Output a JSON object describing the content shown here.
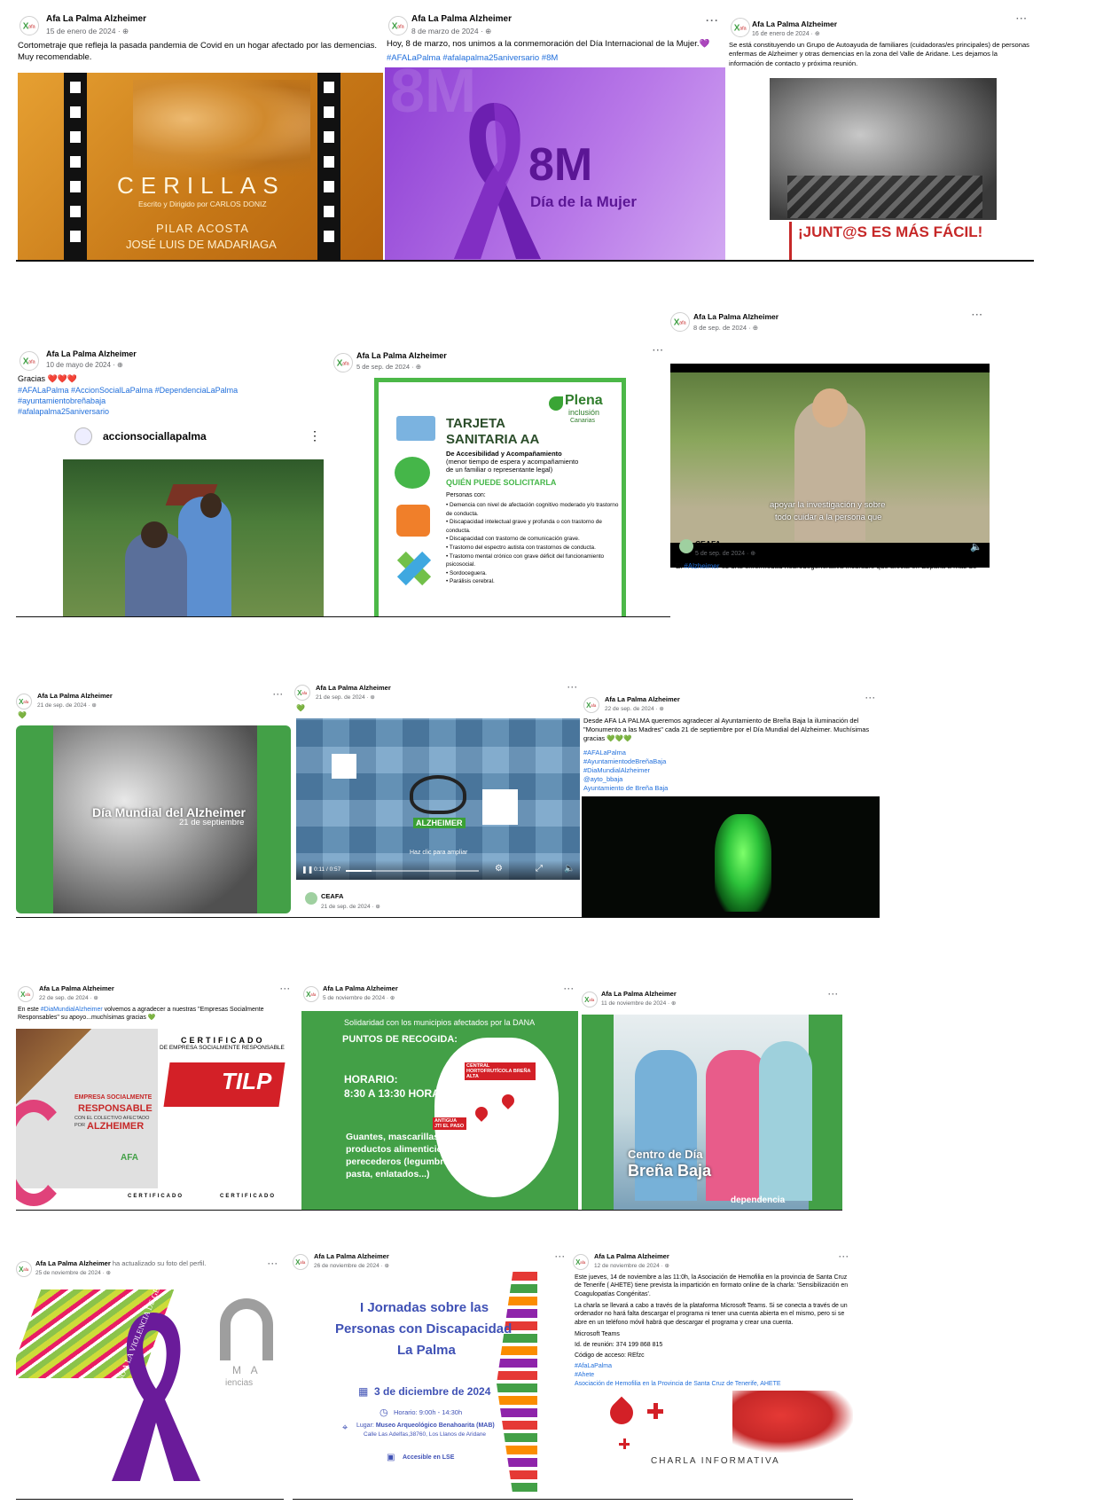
{
  "author": "Afa La Palma Alzheimer",
  "more_label": "···",
  "posts": {
    "p1": {
      "date": "15 de enero de 2024 · ⊕",
      "text": "Cortometraje que refleja la pasada pandemia de Covid en un hogar afectado por las demencias. Muy recomendable.",
      "poster_title": "CERILLAS",
      "poster_sub": "Escrito y Dirigido por CARLOS DONIZ",
      "poster_actor1": "PILAR ACOSTA",
      "poster_actor2": "JOSÉ LUIS DE MADARIAGA"
    },
    "p2": {
      "date": "8 de marzo de 2024 · ⊕",
      "text": "Hoy, 8 de marzo, nos unimos a la conmemoración del Día Internacional de la Mujer.💜",
      "tags": "#AFALaPalma #afalapalma25aniversario #8M",
      "big": "8M",
      "sub": "Día de la Mujer",
      "bg_word": "8M"
    },
    "p3": {
      "date": "16 de enero de 2024 · ⊕",
      "text": "Se está constituyendo un Grupo de Autoayuda de familiares (cuidadoras/es principales) de personas enfermas de Alzheimer y otras demencias en la zona del Valle de Aridane. Les dejamos la información de contacto y próxima reunión.",
      "slogan": "¡JUNT@S ES MÁS FÁCIL!"
    },
    "p4": {
      "date": "10 de mayo de 2024 · ⊕",
      "text": "Gracias ❤️❤️❤️",
      "tags1": "#AFALaPalma #AccionSocialLaPalma #DependenciaLaPalma",
      "tags2": "#ayuntamientobreñabaja",
      "tags3": "#afalapalma25aniversario",
      "ig_account": "accionsociallapalma",
      "ig_more": "⋮"
    },
    "p5": {
      "date": "5 de sep. de 2024 · ⊕",
      "logo1": "Plena",
      "logo2": "inclusión",
      "logo3": "Canarias",
      "title1": "TARJETA",
      "title2": "SANITARIA AA",
      "desc1": "De Accesibilidad y Acompañamiento",
      "desc2": "(menor tiempo de espera y acompañamiento",
      "desc3": "de un familiar o representante legal)",
      "who": "QUIÉN PUEDE SOLICITARLA",
      "people": "Personas con:",
      "items": [
        "Demencia con nivel de afectación cognitivo moderado y/o trastorno de conducta.",
        "Discapacidad intelectual grave y profunda o con trastorno de conducta.",
        "Discapacidad con trastorno de comunicación grave.",
        "Trastorno del espectro autista con trastornos de conducta.",
        "Trastorno mental crónico con grave déficit del funcionamiento psicosocial.",
        "Sordoceguera.",
        "Parálisis cerebral."
      ]
    },
    "p6": {
      "date": "8 de sep. de 2024 · ⊕",
      "caption1": "apoyar la investigación y sobre",
      "caption2": "todo cuidar a la persona que",
      "volume": "🔈",
      "shared_author": "CEAFA",
      "shared_date": "5 de sep. de 2024 · ⊕",
      "shared_text_a": "El ",
      "shared_tag": "#Alzheimer",
      "shared_text_b": " es una enfermedad neurodegenerativa incurable que afecta en España a más de"
    },
    "p7": {
      "date": "21 de sep. de 2024 · ⊕",
      "heart": "💚",
      "title": "Día Mundial del Alzheimer",
      "sub": "21 de septiembre"
    },
    "p8": {
      "date": "21 de sep. de 2024 · ⊕",
      "heart": "💚",
      "badge": "ALZHEIMER",
      "hint": "Haz clic para ampliar",
      "time": "0:11 / 0:57",
      "shared_author": "CEAFA",
      "shared_date": "21 de sep. de 2024 · ⊕"
    },
    "p9": {
      "date": "22 de sep. de 2024 · ⊕",
      "text": "Desde AFA LA PALMA queremos agradecer al Ayuntamiento de Breña Baja la iluminación del \"Monumento a las Madres\" cada 21 de septiembre por el Día Mundial del Alzheimer. Muchísimas gracias 💚💚💚",
      "tags": [
        "#AFALaPalma",
        "#AyuntamientodeBreñaBaja",
        "#DiaMundialAlzheimer",
        "@ayto_bbaja",
        "Ayuntamiento de Breña Baja"
      ]
    },
    "p10": {
      "date": "22 de sep. de 2024 · ⊕",
      "text_a": "En este ",
      "tag": "#DiaMundialAlzheimer",
      "text_b": " volvemos a agradecer a nuestras \"Empresas Socialmente Responsables\" su apoyo...muchísimas gracias 💚",
      "cert_title": "CERTIFICADO",
      "cert_sub": "DE EMPRESA SOCIALMENTE RESPONSABLE",
      "brand": "TILP",
      "esr1": "EMPRESA SOCIALMENTE",
      "esr2": "RESPONSABLE",
      "esr3": "CON EL COLECTIVO AFECTADO",
      "esr4": "POR",
      "esr5": "ALZHEIMER",
      "afa": "AFA",
      "cert_small": "CERTIFICADO"
    },
    "p11": {
      "date": "5 de noviembre de 2024 · ⊕",
      "title": "Solidaridad con los municipios afectados por la DANA",
      "points": "PUNTOS DE RECOGIDA:",
      "horario_label": "HORARIO:",
      "horario": "8:30 A 13:30 HORAS",
      "place1": "CENTRAL HORTOFRUTÍCOLA BREÑA ALTA",
      "place2": "ANTIGUA JTI EL PASO",
      "items1": "Guantes, mascarillas y",
      "items2": "productos alimenticios no",
      "items3": "perecederos (legumbres,",
      "items4": "pasta, enlatados...)"
    },
    "p12": {
      "date": "11 de noviembre de 2024 · ⊕",
      "overlay1": "Centro de Día",
      "overlay2": "Breña Baja",
      "corner": "dependencia"
    },
    "p13": {
      "date": "25 de noviembre de 2024 · ⊕",
      "action": "ha actualizado su foto del perfil.",
      "ribbon": "NO A LA VIOLENCIA DE GÉNERO",
      "letters": "M A",
      "word": "iencias"
    },
    "p14": {
      "date": "26 de noviembre de 2024 · ⊕",
      "title1": "I Jornadas sobre las",
      "title2": "Personas con Discapacidad",
      "title3": "La Palma",
      "when": "3 de diciembre de 2024",
      "horario": "Horario: 9:00h - 14:30h",
      "lugar_label": "Lugar:",
      "lugar": "Museo Arqueológico Benahoarita (MAB)",
      "address": "Calle Las Adelfas,38760, Los Llanos de Aridane",
      "lse": "Accesible en LSE"
    },
    "p15": {
      "date": "12 de noviembre de 2024 · ⊕",
      "line1": "Este jueves, 14 de noviembre a las 11:0h, la Asociación de Hemofilia en la provincia de Santa Cruz de Tenerife ( AHETE) tiene prevista la impartición en formato online de la charla: 'Sensibilización en Coagulopatías Congénitas'.",
      "line2": "La charla se llevará a cabo a través de la plataforma Microsoft Teams. Si se conecta a través de un ordenador no hará falta descargar el programa ni tener una cuenta abierta en el mismo, pero si se abre en un teléfono móvil habrá que descargar el programa y crear una cuenta.",
      "line3": "Microsoft Teams",
      "line4": "Id. de reunión: 374 199 868 815",
      "line5": "Código de acceso: REfzc",
      "tags": [
        "#AfaLaPalma",
        "#Ahete",
        "Asociación de Hemofilia en la Provincia de Santa Cruz de Tenerife, AHETE"
      ],
      "banner": "CHARLA INFORMATIVA"
    }
  },
  "colors": {
    "green": "#43a047",
    "purple": "#7b2fbf",
    "fb_blue": "#216fdb",
    "orange": "#d9891e"
  }
}
